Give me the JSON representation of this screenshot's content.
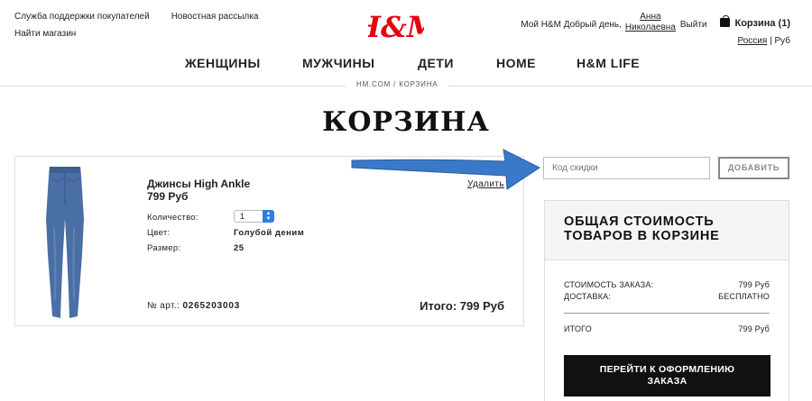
{
  "header": {
    "links": {
      "support": "Служба поддержки покупателей",
      "newsletter": "Новостная рассылка",
      "find_store": "Найти магазин"
    },
    "logo_text": "H&M",
    "account": {
      "greeting": "Мой H&M Добрый день,",
      "first_name": "Анна",
      "last_name": "Николаевна",
      "logout": "Выйти",
      "cart_label": "Корзина (1)",
      "country": "Россия",
      "currency": "Руб"
    }
  },
  "nav": [
    "ЖЕНЩИНЫ",
    "МУЖЧИНЫ",
    "ДЕТИ",
    "HOME",
    "H&M LIFE"
  ],
  "breadcrumb": "HM.COM / КОРЗИНА",
  "page_title": "КОРЗИНА",
  "item": {
    "name": "Джинсы High Ankle",
    "price": "799 Руб",
    "remove_label": "Удалить",
    "quantity_label": "Количество:",
    "quantity_value": "1",
    "color_label": "Цвет:",
    "color_value": "Голубой деним",
    "size_label": "Размер:",
    "size_value": "25",
    "article_label": "№ арт.:",
    "article_value": "0265203003",
    "total": "Итого: 799 Руб",
    "jeans_color": "#4a6fa5"
  },
  "discount": {
    "placeholder": "Код скидки",
    "button": "ДОБАВИТЬ"
  },
  "summary": {
    "title_line1": "ОБЩАЯ СТОИМОСТЬ",
    "title_line2": "ТОВАРОВ В КОРЗИНЕ",
    "order_cost_label": "СТОИМОСТЬ ЗАКАЗА:",
    "order_cost_value": "799 Руб",
    "delivery_label": "ДОСТАВКА:",
    "delivery_value": "БЕСПЛАТНО",
    "total_label": "ИТОГО",
    "total_value": "799 Руб",
    "checkout_line1": "ПЕРЕЙТИ К ОФОРМЛЕНИЮ",
    "checkout_line2": "ЗАКАЗА"
  },
  "colors": {
    "brand_red": "#e50010",
    "arrow_blue": "#3a78c9"
  }
}
